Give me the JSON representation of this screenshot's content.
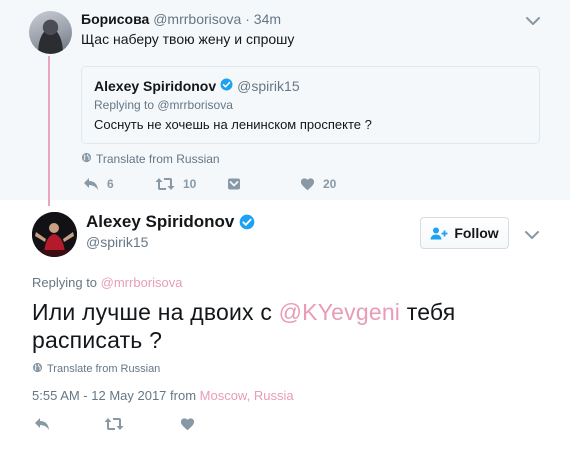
{
  "parent": {
    "name": "Борисова",
    "handle": "@mrrborisova",
    "separator": "·",
    "time": "34m",
    "text": "Щас наберу твою жену и спрошу",
    "quote": {
      "name": "Alexey Spiridonov",
      "handle": "@spirik15",
      "replying_prefix": "Replying to ",
      "replying_handle": "@mrrborisova",
      "text": "Соснуть не хочешь на ленинском проспекте ?"
    },
    "translate": "Translate from Russian",
    "actions": {
      "reply_count": "6",
      "retweet_count": "10",
      "like_count": "20"
    }
  },
  "focus": {
    "name": "Alexey Spiridonov",
    "handle": "@spirik15",
    "follow_label": "Follow",
    "replying_prefix": "Replying to ",
    "replying_handle": "@mrrborisova",
    "text_before": "Или лучше на двоих с ",
    "mention": "@KYevgeni",
    "text_after": " тебя расписать ?",
    "translate": "Translate from Russian",
    "timestamp": "5:55 AM - 12 May 2017 from ",
    "location": "Moscow, Russia"
  },
  "icons": {
    "verified": "verified-badge-icon",
    "reply": "reply-icon",
    "retweet": "retweet-icon",
    "dm": "direct-message-icon",
    "like": "heart-icon",
    "globe": "globe-icon",
    "caret": "chevron-down-icon",
    "follow": "add-person-icon"
  },
  "colors": {
    "link_pink": "#e89cb8",
    "verified_blue": "#1da1f2",
    "action_gray": "#8899a6",
    "parent_bg": "#f5f8fa"
  }
}
